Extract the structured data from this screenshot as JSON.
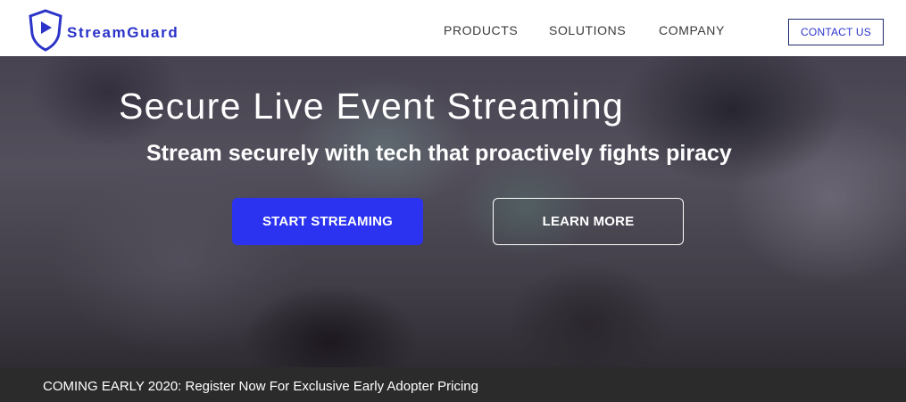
{
  "brand": {
    "name": "StreamGuard",
    "logo_icon": "shield-play-icon",
    "color": "#2b33c9"
  },
  "nav": {
    "items": [
      {
        "label": "PRODUCTS"
      },
      {
        "label": "SOLUTIONS"
      },
      {
        "label": "COMPANY"
      }
    ],
    "contact_label": "CONTACT US"
  },
  "hero": {
    "title": "Secure Live Event Streaming",
    "subtitle": "Stream securely with tech that proactively fights piracy",
    "primary_button": "START STREAMING",
    "secondary_button": "LEARN MORE",
    "primary_color": "#2b33f0"
  },
  "banner": {
    "text": "COMING EARLY 2020: Register Now For Exclusive Early Adopter Pricing"
  }
}
